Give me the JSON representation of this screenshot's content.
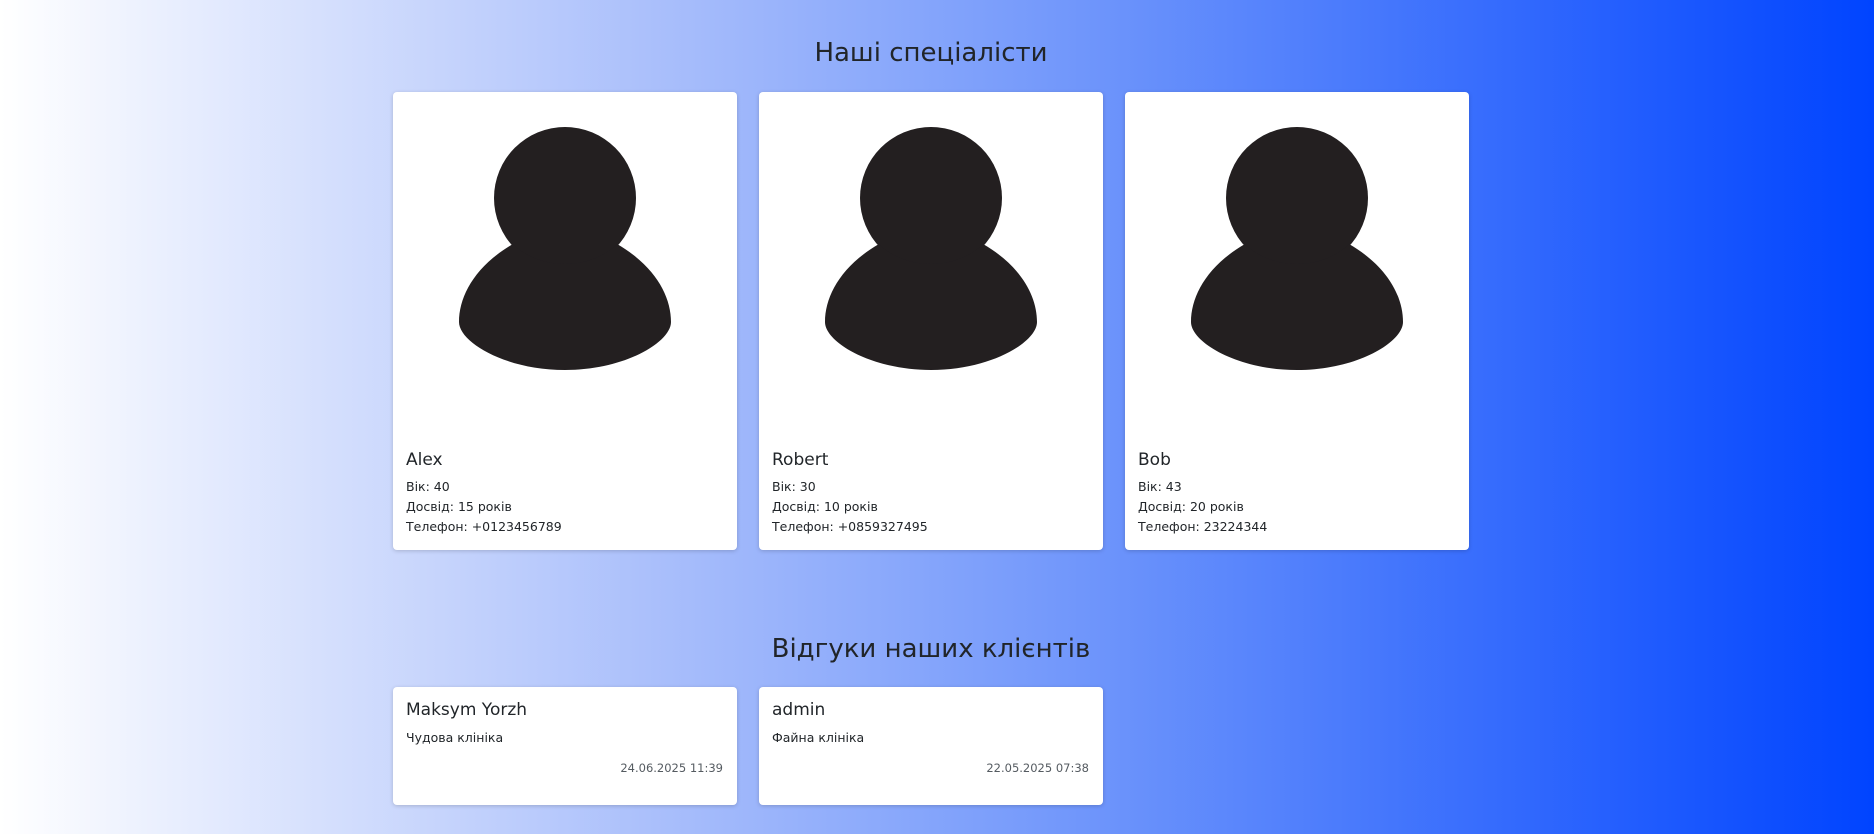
{
  "specialists": {
    "title": "Наші спеціалісти",
    "items": [
      {
        "name": "Alex",
        "age": "Вік: 40",
        "experience": "Досвід: 15 років",
        "phone": "Телефон: +0123456789",
        "avatar_icon": "user-silhouette-icon"
      },
      {
        "name": "Robert",
        "age": "Вік: 30",
        "experience": "Досвід: 10 років",
        "phone": "Телефон: +0859327495",
        "avatar_icon": "user-silhouette-icon"
      },
      {
        "name": "Bob",
        "age": "Вік: 43",
        "experience": "Досвід: 20 років",
        "phone": "Телефон: 23224344",
        "avatar_icon": "user-silhouette-icon"
      }
    ]
  },
  "reviews": {
    "title": "Відгуки наших клієнтів",
    "items": [
      {
        "author": "Maksym Yorzh",
        "text": "Чудова клініка",
        "date": "24.06.2025 11:39"
      },
      {
        "author": "admin",
        "text": "Файна клініка",
        "date": "22.05.2025 07:38"
      }
    ]
  },
  "colors": {
    "gradient_start": "#ffffff",
    "gradient_end": "#0044ff",
    "avatar_fill": "#231f20"
  }
}
